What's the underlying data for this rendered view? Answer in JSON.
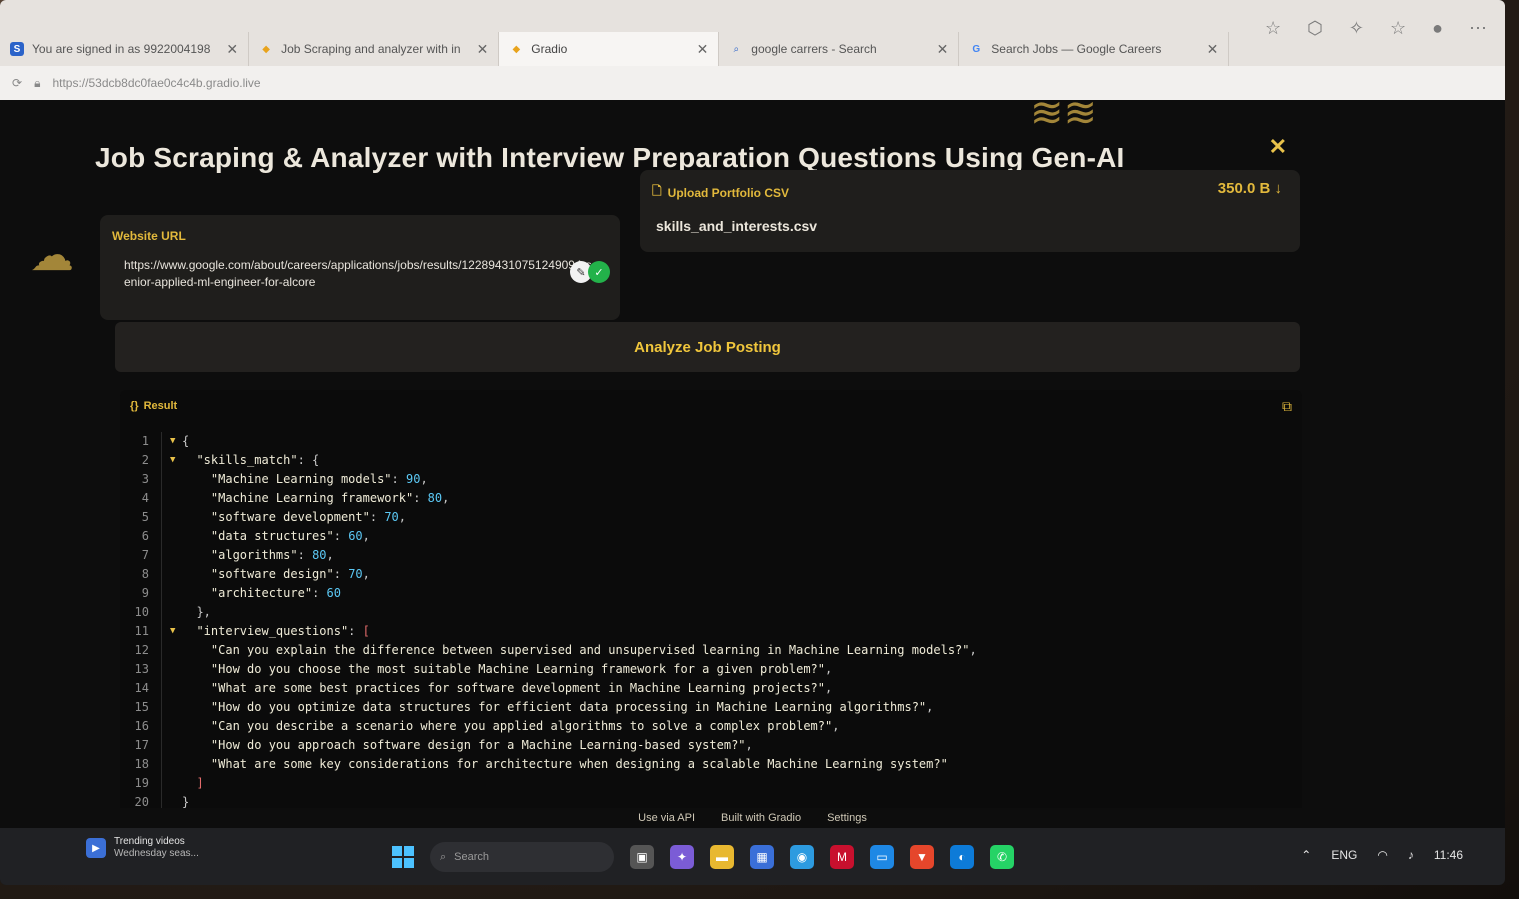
{
  "browser": {
    "tabs": [
      {
        "label": "You are signed in as 9922004198",
        "icon": "s-favicon",
        "active": false
      },
      {
        "label": "Job Scraping and analyzer with in",
        "icon": "gradio-favicon",
        "active": false
      },
      {
        "label": "Gradio",
        "icon": "gradio-favicon",
        "active": true
      },
      {
        "label": "google carrers - Search",
        "icon": "search-icon",
        "active": false
      },
      {
        "label": "Search Jobs — Google Careers",
        "icon": "google-icon",
        "active": false
      }
    ],
    "url": "https://53dcb8dc0fae0c4c4b.gradio.live"
  },
  "app": {
    "title": "Job Scraping & Analyzer with Interview Preparation Questions Using Gen-AI",
    "website_url_label": "Website URL",
    "website_url_value": "https://www.google.com/about/careers/applications/jobs/results/122894310751249094-senior-applied-ml-engineer-for-alcore",
    "upload_label": "Upload Portfolio CSV",
    "file_name": "skills_and_interests.csv",
    "file_size": "350.0 B",
    "analyze_button": "Analyze Job Posting",
    "result_label": "Result",
    "result_json": {
      "skills_match": [
        {
          "key": "Machine Learning models",
          "value": 90
        },
        {
          "key": "Machine Learning framework",
          "value": 80
        },
        {
          "key": "software development",
          "value": 70
        },
        {
          "key": "data structures",
          "value": 60
        },
        {
          "key": "algorithms",
          "value": 80
        },
        {
          "key": "software design",
          "value": 70
        },
        {
          "key": "architecture",
          "value": 60
        }
      ],
      "interview_questions": [
        "Can you explain the difference between supervised and unsupervised learning in Machine Learning models?",
        "How do you choose the most suitable Machine Learning framework for a given problem?",
        "What are some best practices for software development in Machine Learning projects?",
        "How do you optimize data structures for efficient data processing in Machine Learning algorithms?",
        "Can you describe a scenario where you applied algorithms to solve a complex problem?",
        "How do you approach software design for a Machine Learning-based system?",
        "What are some key considerations for architecture when designing a scalable Machine Learning system?"
      ]
    },
    "footer": [
      "Use via API",
      "Built with Gradio",
      "Settings"
    ]
  },
  "taskbar": {
    "trending_title": "Trending videos",
    "trending_sub": "Wednesday seas...",
    "search_placeholder": "Search",
    "language": "ENG",
    "time": "11:46"
  },
  "colors": {
    "accent": "#e2b93c",
    "number": "#5cc9f5",
    "bracket": "#e36b6b"
  }
}
